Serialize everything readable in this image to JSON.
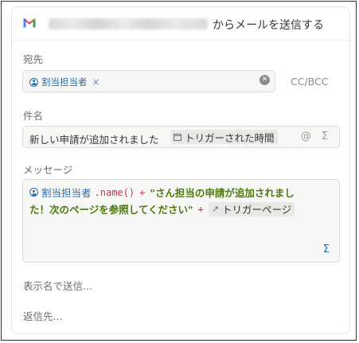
{
  "header": {
    "title_suffix": "からメールを送信する"
  },
  "to": {
    "label": "宛先",
    "chip_label": "割当担当者",
    "remove_glyph": "×",
    "clear_glyph": "✕",
    "ccbcc": "CC/BCC"
  },
  "subject": {
    "label": "件名",
    "text": "新しい申請が追加されました",
    "token": "トリガーされた時間",
    "mention_glyph": "@",
    "sigma_glyph": "Σ"
  },
  "message": {
    "label": "メッセージ",
    "person": "割当担当者",
    "method": ".name()",
    "plus": "+",
    "string_line1": "\"さん担当の申請が追加されまし",
    "string_line2": "た！次のページを参照してください\"",
    "link_glyph": "↗",
    "link_label": "トリガーページ",
    "sigma_glyph": "Σ"
  },
  "footer": {
    "send_as": "表示名で送信...",
    "reply_to": "返信先..."
  },
  "colors": {
    "accent_blue": "#2b6cb0",
    "string_green": "#4d7a0e",
    "method_pink": "#c0365a"
  }
}
